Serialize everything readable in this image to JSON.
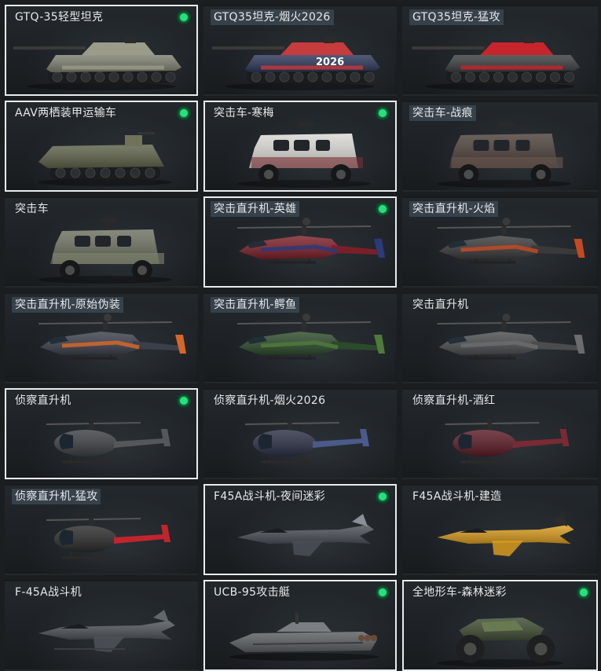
{
  "vehicles": [
    {
      "name": "GTQ-35轻型坦克",
      "kind": "tank",
      "selected": true,
      "equipped": true,
      "highlight": false,
      "body": "#7c7d6e",
      "accent": "#9a9b88"
    },
    {
      "name": "GTQ35坦克-烟火2026",
      "kind": "tank",
      "selected": false,
      "equipped": false,
      "highlight": true,
      "body": "#2b3556",
      "accent": "#c63b3b",
      "decal": "2026"
    },
    {
      "name": "GTQ35坦克-猛攻",
      "kind": "tank",
      "selected": false,
      "equipped": false,
      "highlight": true,
      "body": "#3a3c3e",
      "accent": "#c8242c"
    },
    {
      "name": "AAV两栖装甲运输车",
      "kind": "aav",
      "selected": true,
      "equipped": true,
      "highlight": false,
      "body": "#5c6148",
      "accent": "#6f7458"
    },
    {
      "name": "突击车-寒梅",
      "kind": "truck",
      "selected": true,
      "equipped": true,
      "highlight": false,
      "body": "#d9d8d4",
      "accent": "#7a3036"
    },
    {
      "name": "突击车-战痕",
      "kind": "truck",
      "selected": false,
      "equipped": false,
      "highlight": true,
      "body": "#4a3f38",
      "accent": "#6a5a50"
    },
    {
      "name": "突击车",
      "kind": "truck",
      "selected": false,
      "equipped": false,
      "highlight": false,
      "body": "#6c7060",
      "accent": "#82866f"
    },
    {
      "name": "突击直升机-英雄",
      "kind": "heli",
      "selected": true,
      "equipped": true,
      "highlight": true,
      "body": "#7a1f28",
      "accent": "#2a3a7a"
    },
    {
      "name": "突击直升机-火焰",
      "kind": "heli",
      "selected": false,
      "equipped": false,
      "highlight": true,
      "body": "#3a3a3a",
      "accent": "#c24a22"
    },
    {
      "name": "突击直升机-原始伪装",
      "kind": "heli",
      "selected": false,
      "equipped": false,
      "highlight": true,
      "body": "#3b3f4a",
      "accent": "#d4672a"
    },
    {
      "name": "突击直升机-鳄鱼",
      "kind": "heli",
      "selected": false,
      "equipped": false,
      "highlight": true,
      "body": "#2c4a2a",
      "accent": "#4f7a3c"
    },
    {
      "name": "突击直升机",
      "kind": "heli",
      "selected": false,
      "equipped": false,
      "highlight": false,
      "body": "#4a4c4e",
      "accent": "#6a6c6e"
    },
    {
      "name": "侦察直升机",
      "kind": "scout",
      "selected": true,
      "equipped": true,
      "highlight": false,
      "body": "#3c3f42",
      "accent": "#55585b"
    },
    {
      "name": "侦察直升机-烟火2026",
      "kind": "scout",
      "selected": false,
      "equipped": false,
      "highlight": false,
      "body": "#2a2f44",
      "accent": "#4b5a8a"
    },
    {
      "name": "侦察直升机-酒红",
      "kind": "scout",
      "selected": false,
      "equipped": false,
      "highlight": false,
      "body": "#5a1a24",
      "accent": "#7a2a34"
    },
    {
      "name": "侦察直升机-猛攻",
      "kind": "scout",
      "selected": false,
      "equipped": false,
      "highlight": true,
      "body": "#2a2a2a",
      "accent": "#c0252d"
    },
    {
      "name": "F45A战斗机-夜间迷彩",
      "kind": "jet",
      "selected": true,
      "equipped": true,
      "highlight": false,
      "body": "#4a4f56",
      "accent": "#8a9098"
    },
    {
      "name": "F45A战斗机-建造",
      "kind": "jet",
      "selected": false,
      "equipped": false,
      "highlight": false,
      "body": "#d79a1f",
      "accent": "#2b2b2b"
    },
    {
      "name": "F-45A战斗机",
      "kind": "jet2",
      "selected": false,
      "equipped": false,
      "highlight": false,
      "body": "#4d5258",
      "accent": "#62676d"
    },
    {
      "name": "UCB-95攻击艇",
      "kind": "boat",
      "selected": true,
      "equipped": true,
      "highlight": false,
      "body": "#5a5e62",
      "accent": "#7a7e82"
    },
    {
      "name": "全地形车-森林迷彩",
      "kind": "atv",
      "selected": true,
      "equipped": true,
      "highlight": false,
      "body": "#3e4b32",
      "accent": "#6a7a50"
    }
  ]
}
